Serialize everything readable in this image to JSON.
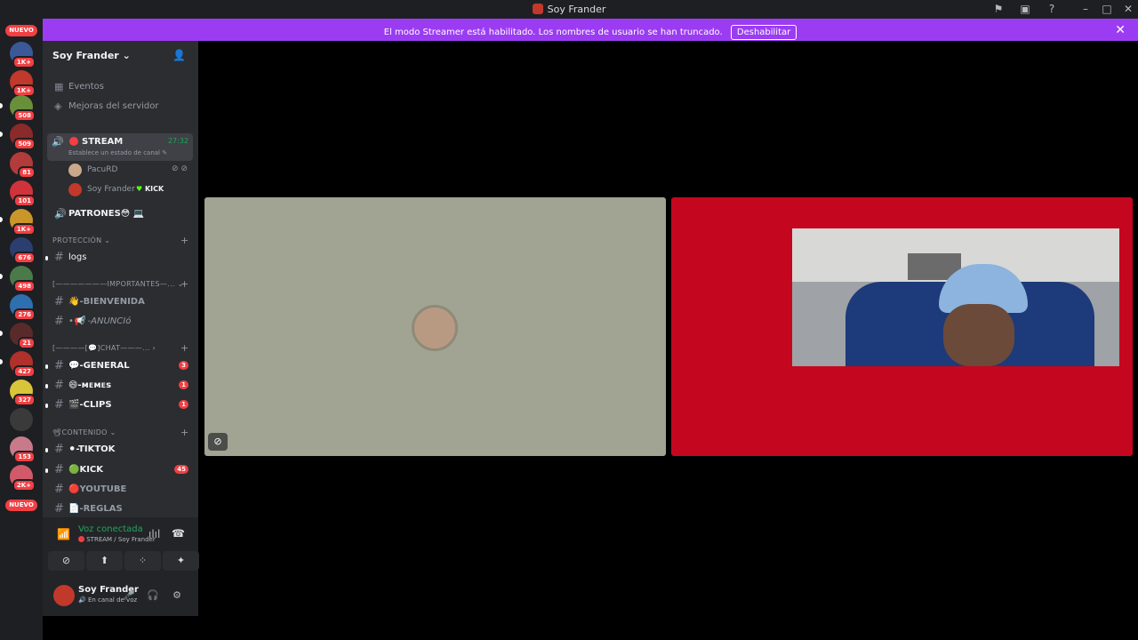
{
  "window": {
    "title": "Soy Frander"
  },
  "banner": {
    "message": "El modo Streamer está habilitado. Los nombres de usuario se han truncado.",
    "button": "Deshabilitar"
  },
  "guilds": {
    "new_label": "NUEVO",
    "badges": [
      "1K+",
      "1K+",
      "508",
      "509",
      "81",
      "101",
      "1K+",
      "676",
      "498",
      "276",
      "21",
      "427",
      "327",
      "153",
      "2K+"
    ]
  },
  "server": {
    "name": "Soy Frander",
    "top_items": [
      "Eventos",
      "Mejoras del servidor"
    ],
    "voice_channel": {
      "name": "STREAM",
      "timer": "27:32",
      "status_hint": "Establece un estado de canal"
    },
    "voice_users": [
      {
        "name": "PacuRD",
        "tag": ""
      },
      {
        "name": "Soy Frander",
        "tag": "KICK"
      }
    ],
    "patrones": "PATRONES😳 💻",
    "categories": [
      {
        "name": "PROTECCIÓN",
        "channels": [
          {
            "name": "logs",
            "badge": ""
          }
        ]
      },
      {
        "name": "[———————IMPORTANTES—...",
        "channels": [
          {
            "name": "👋-BIENVENIDA",
            "badge": ""
          },
          {
            "name": "•📢 -ANUNCIó",
            "badge": ""
          }
        ]
      },
      {
        "name": "[————[💬]CHAT———...",
        "channels": [
          {
            "name": "💬-GENERAL",
            "badge": "3"
          },
          {
            "name": "😄-ᴍᴇᴍᴇs",
            "badge": "1"
          },
          {
            "name": "🎬-CLIPS",
            "badge": "1"
          }
        ]
      },
      {
        "name": "CONTENIDO",
        "channels": [
          {
            "name": "⚫-TIKTOK",
            "badge": ""
          },
          {
            "name": "🟢KICK",
            "badge": "45"
          },
          {
            "name": "🔴YOUTUBE",
            "badge": ""
          },
          {
            "name": "📄-REGLAS",
            "badge": ""
          }
        ]
      }
    ]
  },
  "panel": {
    "voice_status": "Voz conectada",
    "voice_location": "STREAM / Soy Frander",
    "user_name": "Soy Frander",
    "user_status": "En canal de voz"
  },
  "colors": {
    "accent": "#9b3cf2",
    "danger": "#f23f43",
    "connected": "#23a55a",
    "tile_left": "#a1a393",
    "tile_right": "#c4071e"
  }
}
